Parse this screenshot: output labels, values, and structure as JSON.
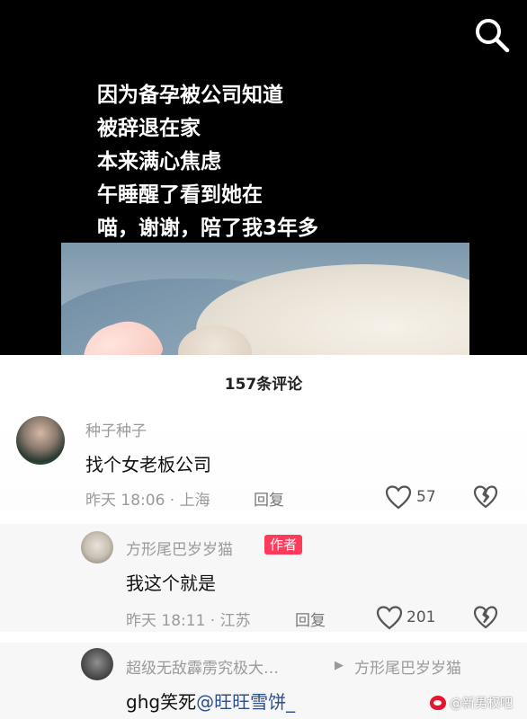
{
  "video": {
    "caption_lines": [
      "因为备孕被公司知道",
      "被辞退在家",
      "本来满心焦虑",
      "午睡醒了看到她在",
      "喵，谢谢，陪了我3年多"
    ],
    "search_icon": "search-icon"
  },
  "comments_panel": {
    "count_text": "157条评论",
    "comments": [
      {
        "user": "种子种子",
        "text": "找个女老板公司",
        "meta": "昨天 18:06 · 上海",
        "reply_label": "回复",
        "likes": "57"
      },
      {
        "user": "方形尾巴岁岁猫",
        "badge": "作者",
        "text": "我这个就是",
        "meta": "昨天 18:11 · 江苏",
        "reply_label": "回复",
        "likes": "201"
      },
      {
        "user": "超级无敌霹雳究极大…",
        "reply_arrow": "▶",
        "reply_to": "方形尾巴岁岁猫",
        "text_prefix": "ghg笑死",
        "mention": "@旺旺雪饼_"
      }
    ]
  },
  "watermark": {
    "text": "@新男权吧"
  },
  "colors": {
    "author_badge": "#ff3b5c",
    "mention": "#2d4f8c"
  }
}
